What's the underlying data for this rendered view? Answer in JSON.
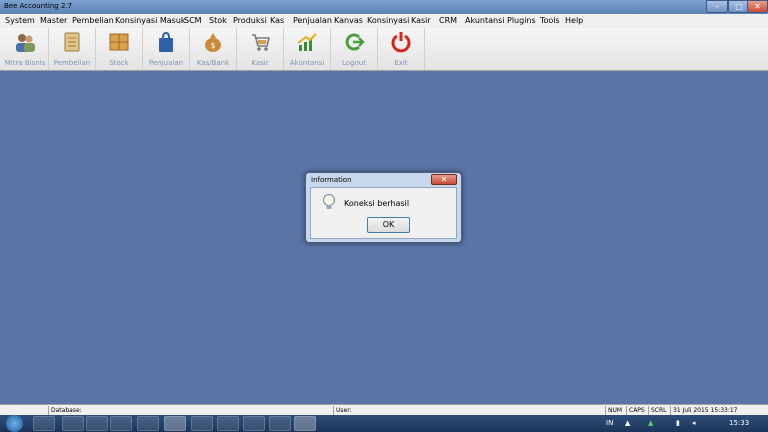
{
  "window": {
    "title": "Bee Accounting 2.7",
    "minimize": "–",
    "maximize": "□",
    "close": "✕"
  },
  "menu": [
    "System",
    "Master",
    "Pembelian",
    "Konsinyasi Masuk",
    "SCM",
    "Stok",
    "Produksi",
    "Kas",
    "Penjualan",
    "Kanvas",
    "Konsinyasi",
    "Kasir",
    "CRM",
    "Akuntansi",
    "Plugins",
    "Tools",
    "Help"
  ],
  "toolbar": [
    {
      "label": "Mitra Bisnis",
      "icon": "people-icon"
    },
    {
      "label": "Pembelian",
      "icon": "notebook-icon"
    },
    {
      "label": "Stock",
      "icon": "boxes-icon"
    },
    {
      "label": "Penjualan",
      "icon": "shopping-bag-icon"
    },
    {
      "label": "Kas/Bank",
      "icon": "money-bag-icon"
    },
    {
      "label": "Kasir",
      "icon": "cash-register-icon"
    },
    {
      "label": "Akuntansi",
      "icon": "growth-chart-icon"
    },
    {
      "label": "Logout",
      "icon": "logout-arrow-icon"
    },
    {
      "label": "Exit",
      "icon": "power-icon"
    }
  ],
  "dialog": {
    "title": "Information",
    "message": "Koneksi berhasil",
    "ok_label": "OK",
    "close": "✕"
  },
  "statusbar": {
    "database_label": "Database:",
    "user_label": "User:",
    "num": "NUM",
    "caps": "CAPS",
    "scrl": "SCRL",
    "datetime": "31 Juli 2015  15:33:17"
  },
  "taskbar": {
    "lang": "IN",
    "clock": "15:33"
  },
  "colors": {
    "desktop": "#5a74a6",
    "toolbar_label": "#7d95b6"
  }
}
